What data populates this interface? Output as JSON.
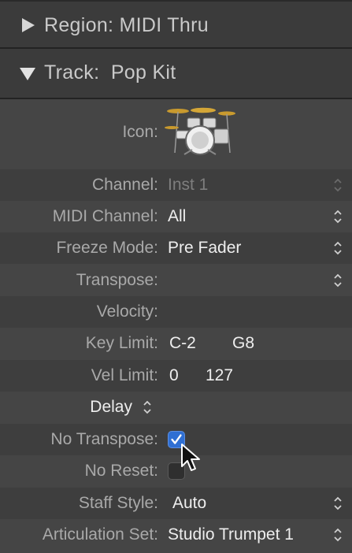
{
  "region": {
    "label": "Region:",
    "value": "MIDI Thru"
  },
  "track": {
    "label": "Track:",
    "value": "Pop Kit"
  },
  "icon_label": "Icon:",
  "icon_name": "drum-kit-icon",
  "rows": {
    "channel": {
      "label": "Channel:",
      "value": "Inst 1"
    },
    "midi_channel": {
      "label": "MIDI Channel:",
      "value": "All"
    },
    "freeze_mode": {
      "label": "Freeze Mode:",
      "value": "Pre Fader"
    },
    "transpose": {
      "label": "Transpose:",
      "value": ""
    },
    "velocity": {
      "label": "Velocity:",
      "value": ""
    },
    "key_limit": {
      "label": "Key Limit:",
      "low": "C-2",
      "high": "G8"
    },
    "vel_limit": {
      "label": "Vel Limit:",
      "low": "0",
      "high": "127"
    },
    "delay": {
      "label": "Delay"
    },
    "no_transpose": {
      "label": "No Transpose:",
      "checked": true
    },
    "no_reset": {
      "label": "No Reset:",
      "checked": false
    },
    "staff_style": {
      "label": "Staff Style:",
      "value": "Auto"
    },
    "articulation_set": {
      "label": "Articulation Set:",
      "value": "Studio Trumpet 1"
    }
  },
  "colors": {
    "checkbox_accent": "#2f6fd3",
    "panel_bg": "#454545",
    "header_bg": "#3b3b3b"
  }
}
